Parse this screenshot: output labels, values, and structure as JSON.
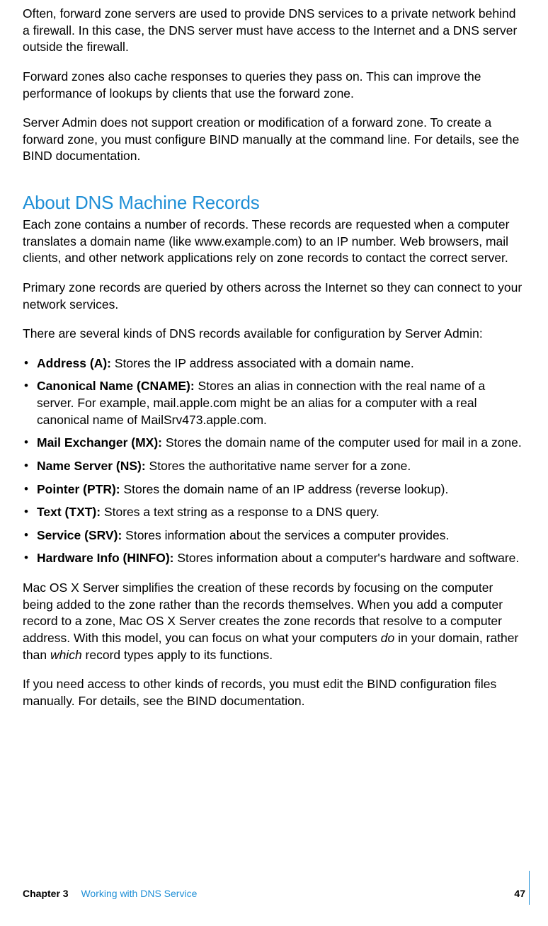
{
  "paragraphs": {
    "p1": "Often, forward zone servers are used to provide DNS services to a private network behind a firewall. In this case, the DNS server must have access to the Internet and a DNS server outside the firewall.",
    "p2": "Forward zones also cache responses to queries they pass on. This can improve the performance of lookups by clients that use the forward zone.",
    "p3": "Server Admin does not support creation or modification of a forward zone. To create a forward zone, you must configure BIND manually at the command line. For details, see the BIND documentation.",
    "p4": "Each zone contains a number of records. These records are requested when a computer translates a domain name (like www.example.com) to an IP number. Web browsers, mail clients, and other network applications rely on zone records to contact the correct server.",
    "p5": "Primary zone records are queried by others across the Internet so they can connect to your network services.",
    "p6": "There are several kinds of DNS records available for configuration by Server Admin:",
    "p7a": "Mac OS X Server simplifies the creation of these records by focusing on the computer being added to the zone rather than the records themselves. When you add a computer record to a zone, Mac OS X Server creates the zone records that resolve to a computer address. With this model, you can focus on what your computers ",
    "p7b": "do",
    "p7c": " in your domain, rather than ",
    "p7d": "which",
    "p7e": " record types apply to its functions.",
    "p8": "If you need access to other kinds of records, you must edit the BIND configuration files manually. For details, see the BIND documentation."
  },
  "heading": "About DNS Machine Records",
  "records": [
    {
      "term": "Address (A):  ",
      "desc": "Stores the IP address associated with a domain name."
    },
    {
      "term": "Canonical Name (CNAME):  ",
      "desc": "Stores an alias in connection with the real name of a server. For example, mail.apple.com might be an alias for a computer with a real canonical name of MailSrv473.apple.com."
    },
    {
      "term": "Mail Exchanger (MX):  ",
      "desc": "Stores the domain name of the computer used for mail in a zone."
    },
    {
      "term": "Name Server (NS):  ",
      "desc": "Stores the authoritative name server for a zone."
    },
    {
      "term": "Pointer (PTR):  ",
      "desc": "Stores the domain name of an IP address (reverse lookup)."
    },
    {
      "term": "Text (TXT):  ",
      "desc": "Stores a text string as a response to a DNS query."
    },
    {
      "term": "Service (SRV):  ",
      "desc": "Stores information about the services a computer provides."
    },
    {
      "term": "Hardware Info (HINFO):  ",
      "desc": "Stores information about a computer's hardware and software."
    }
  ],
  "footer": {
    "chapter_label": "Chapter 3",
    "chapter_title": "Working with DNS Service",
    "page_number": "47"
  }
}
